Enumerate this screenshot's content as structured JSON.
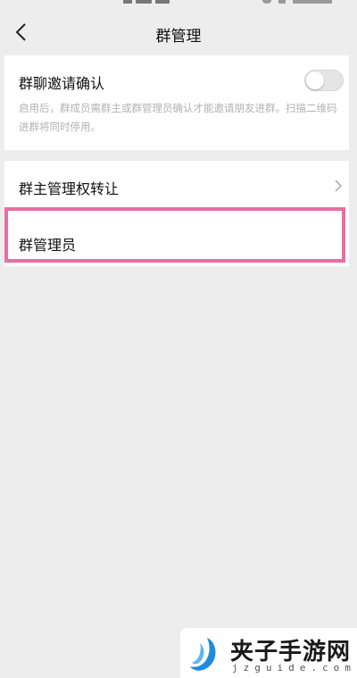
{
  "nav": {
    "title": "群管理"
  },
  "invite_confirm": {
    "title": "群聊邀请确认",
    "description": "启用后，群成员需群主或群管理员确认才能邀请朋友进群。扫描二维码进群将同时停用。",
    "enabled": false
  },
  "transfer_owner": {
    "title": "群主管理权转让"
  },
  "admins": {
    "title": "群管理员"
  },
  "watermark": {
    "name": "夹子手游网",
    "url": "jzguide.com"
  },
  "colors": {
    "highlight": "#e96ea2",
    "background": "#ededed",
    "card": "#ffffff"
  },
  "icons": {
    "back": "back-arrow-icon",
    "chevron": "chevron-right-icon",
    "toggle": "toggle-switch"
  }
}
